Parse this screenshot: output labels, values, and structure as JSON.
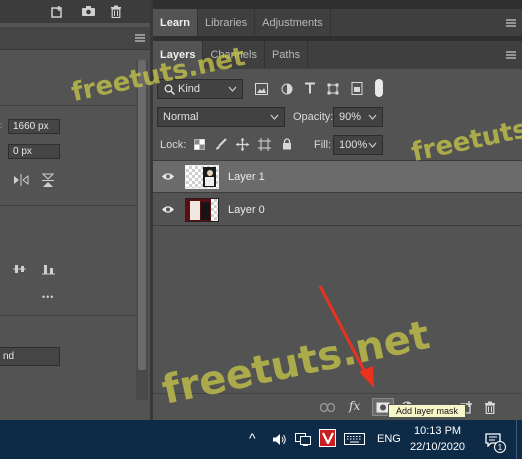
{
  "left": {
    "width_value": "1660 px",
    "offset_value": "0 px",
    "bottom_field_value": "nd",
    "more_label": "•••"
  },
  "tabs_top": [
    {
      "label": "Learn",
      "active": true
    },
    {
      "label": "Libraries",
      "active": false
    },
    {
      "label": "Adjustments",
      "active": false
    }
  ],
  "tabs_layers": [
    {
      "label": "Layers",
      "active": true
    },
    {
      "label": "Channels",
      "active": false
    },
    {
      "label": "Paths",
      "active": false
    }
  ],
  "filter": {
    "kind_label": "Kind"
  },
  "blend": {
    "mode": "Normal",
    "opacity_label": "Opacity:",
    "opacity_value": "90%"
  },
  "lock": {
    "label": "Lock:",
    "fill_label": "Fill:",
    "fill_value": "100%"
  },
  "layers": [
    {
      "name": "Layer 1",
      "selected": true
    },
    {
      "name": "Layer 0",
      "selected": false
    }
  ],
  "tooltip": "Add layer mask",
  "fx_label": "fx",
  "watermark": "freetuts.net",
  "taskbar": {
    "language": "ENG",
    "time": "10:13 PM",
    "date": "22/10/2020",
    "notification_count": "1",
    "chevron": "^"
  },
  "colors": {
    "accent_arrow": "#e8321e",
    "taskbar": "#0d2a47"
  }
}
